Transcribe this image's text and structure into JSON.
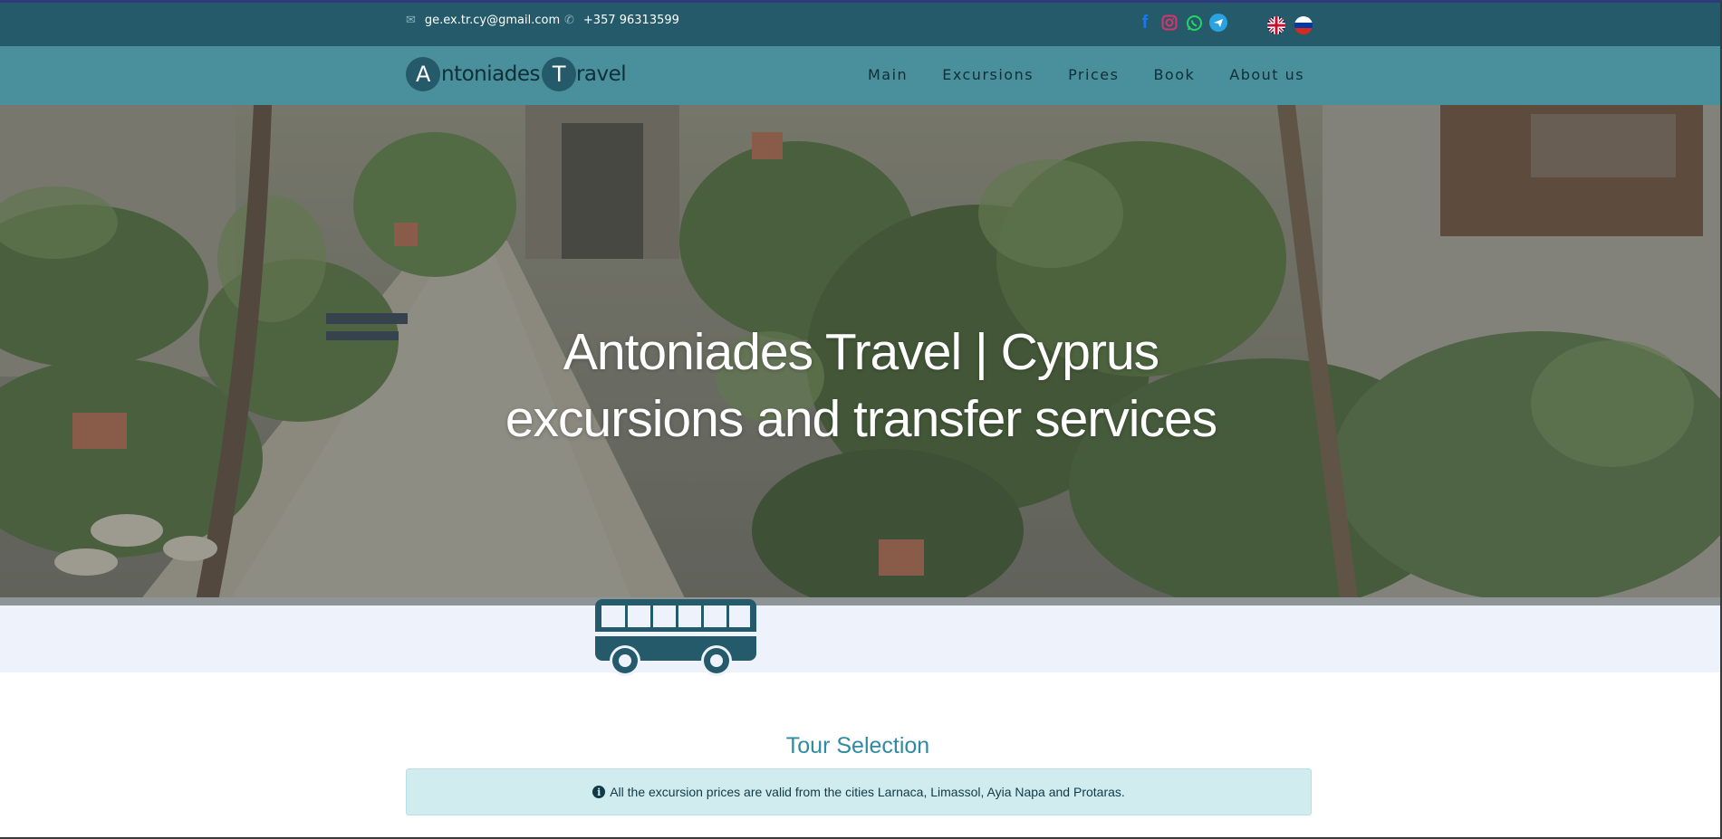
{
  "topbar": {
    "email": "ge.ex.tr.cy@gmail.com",
    "phone": "+357 96313599",
    "email_icon": "envelope-icon",
    "phone_icon": "phone-icon",
    "socials": [
      {
        "name": "facebook-icon",
        "glyph": "f",
        "color": "#1877f2"
      },
      {
        "name": "instagram-icon",
        "glyph": "◎",
        "color": "#e1306c"
      },
      {
        "name": "whatsapp-icon",
        "glyph": "✆",
        "color": "#25d366"
      },
      {
        "name": "telegram-icon",
        "glyph": "➤",
        "color": "#2aa3e0"
      }
    ],
    "languages": [
      "english-flag-icon",
      "russian-flag-icon"
    ]
  },
  "logo": {
    "first_initial": "A",
    "first_rest": "ntoniades",
    "second_initial": "T",
    "second_rest": "ravel"
  },
  "nav": {
    "items": [
      "Main",
      "Excursions",
      "Prices",
      "Book",
      "About us"
    ]
  },
  "hero": {
    "line1": "Antoniades Travel | Cyprus",
    "line2": "excursions and transfer services"
  },
  "section": {
    "title": "Tour Selection"
  },
  "info": {
    "icon": "i",
    "text": "All the excursion prices are valid from the cities Larnaca, Limassol, Ayia Napa and Protaras."
  },
  "colors": {
    "topbar": "#245a6a",
    "navbar": "#4a8f9c",
    "accent": "#2f8aa3",
    "info_bg": "#d1ecef",
    "bus": "#245a6a"
  }
}
